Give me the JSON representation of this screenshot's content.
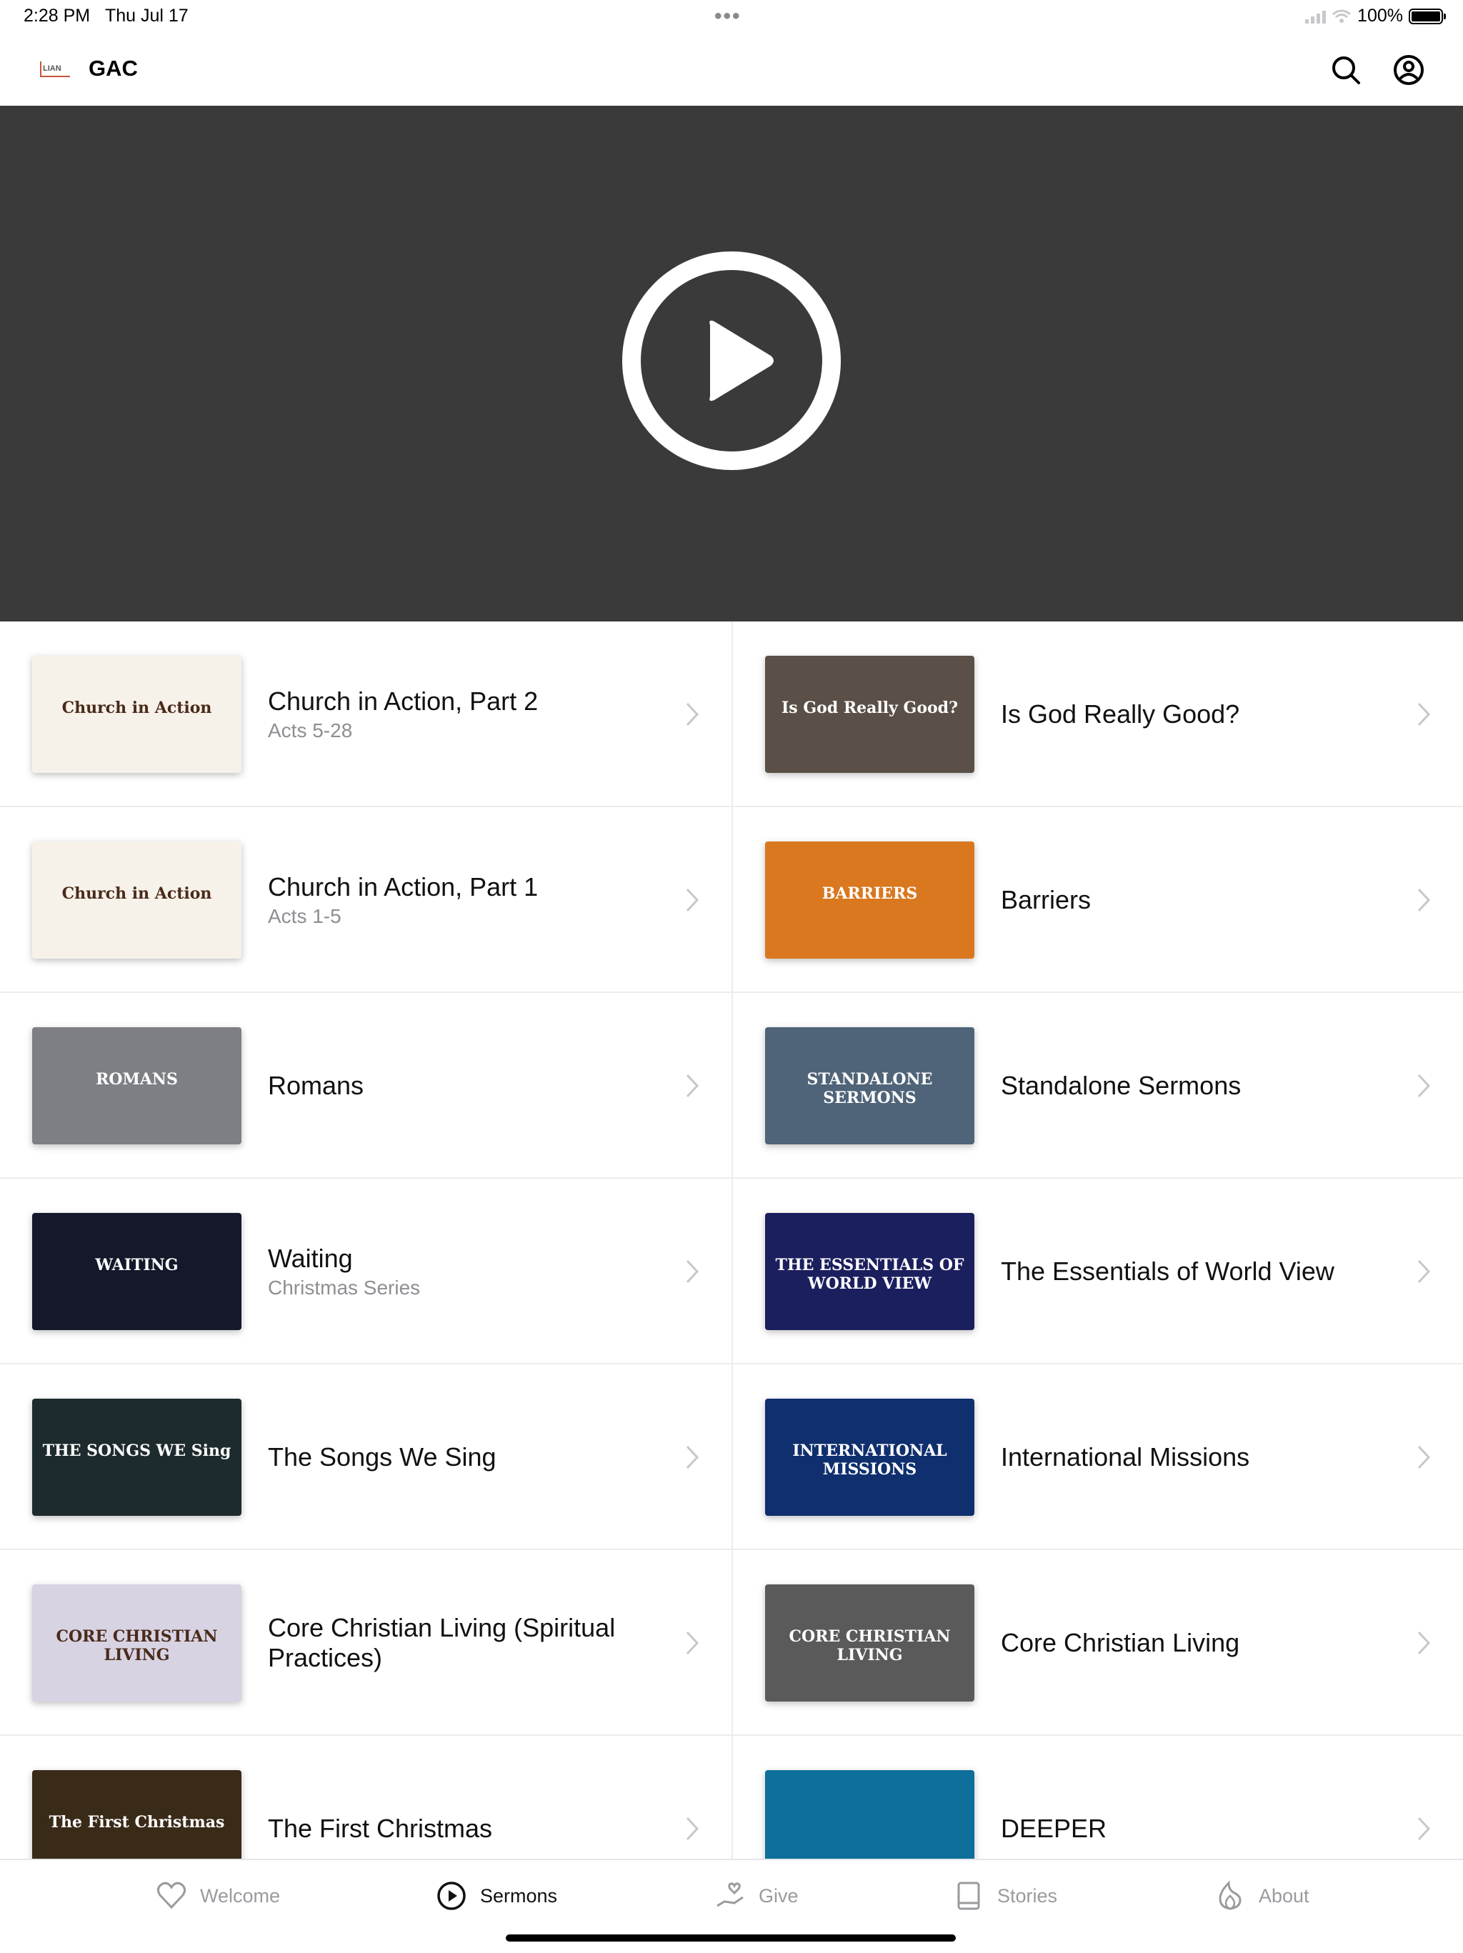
{
  "status_bar": {
    "time": "2:28 PM",
    "date": "Thu Jul 17",
    "battery": "100%",
    "more_dots": "•••"
  },
  "header": {
    "logo_text": "LIAN",
    "title": "GAC",
    "search_icon": "search-icon",
    "account_icon": "account-icon"
  },
  "video": {
    "play_icon": "play-circle-icon",
    "background": "#3a3a3a"
  },
  "sermons": [
    {
      "title": "Church in Action, Part 2",
      "subtitle": "Acts 5-28",
      "thumb_text": "Church in Action",
      "thumb_bg": "#f6f2ea"
    },
    {
      "title": "Is God Really Good?",
      "subtitle": "",
      "thumb_text": "Is God Really Good?",
      "thumb_bg": "#5a5047"
    },
    {
      "title": "Church in Action, Part 1",
      "subtitle": "Acts 1-5",
      "thumb_text": "Church in Action",
      "thumb_bg": "#f6f2ea"
    },
    {
      "title": "Barriers",
      "subtitle": "",
      "thumb_text": "BARRIERS",
      "thumb_bg": "#d9781f"
    },
    {
      "title": "Romans",
      "subtitle": "",
      "thumb_text": "ROMANS",
      "thumb_bg": "#7d7f84"
    },
    {
      "title": "Standalone Sermons",
      "subtitle": "",
      "thumb_text": "STANDALONE SERMONS",
      "thumb_bg": "#4f6478"
    },
    {
      "title": "Waiting",
      "subtitle": "Christmas Series",
      "thumb_text": "WAITING",
      "thumb_bg": "#14182a"
    },
    {
      "title": "The Essentials of World View",
      "subtitle": "",
      "thumb_text": "THE ESSENTIALS OF WORLD VIEW",
      "thumb_bg": "#1c1f5e"
    },
    {
      "title": "The Songs We Sing",
      "subtitle": "",
      "thumb_text": "THE SONGS WE Sing",
      "thumb_bg": "#1e2b2e"
    },
    {
      "title": "International Missions",
      "subtitle": "",
      "thumb_text": "INTERNATIONAL MISSIONS",
      "thumb_bg": "#0f2f6e"
    },
    {
      "title": "Core Christian Living (Spiritual Practices)",
      "subtitle": "",
      "thumb_text": "CORE CHRISTIAN LIVING",
      "thumb_bg": "#d8d3e3"
    },
    {
      "title": "Core Christian Living",
      "subtitle": "",
      "thumb_text": "CORE CHRISTIAN LIVING",
      "thumb_bg": "#5a5a5a"
    },
    {
      "title": "The First Christmas",
      "subtitle": "",
      "thumb_text": "The First Christmas",
      "thumb_bg": "#3a2a18"
    },
    {
      "title": "DEEPER",
      "subtitle": "",
      "thumb_text": "",
      "thumb_bg": "#0d6f9a"
    }
  ],
  "tabs": [
    {
      "label": "Welcome",
      "icon": "heart-icon",
      "active": false
    },
    {
      "label": "Sermons",
      "icon": "play-circle-icon",
      "active": true
    },
    {
      "label": "Give",
      "icon": "hand-heart-icon",
      "active": false
    },
    {
      "label": "Stories",
      "icon": "book-icon",
      "active": false
    },
    {
      "label": "About",
      "icon": "flame-icon",
      "active": false
    }
  ]
}
